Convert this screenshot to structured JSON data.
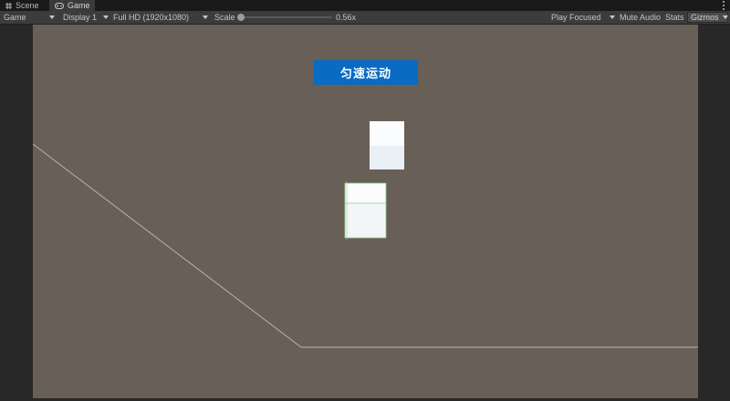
{
  "tabs": [
    {
      "label": "Scene",
      "icon": "grid-icon",
      "active": false
    },
    {
      "label": "Game",
      "icon": "gamepad-icon",
      "active": true
    }
  ],
  "toolbar": {
    "view_mode": "Game",
    "display": "Display 1",
    "resolution": "Full HD (1920x1080)",
    "scale_label": "Scale",
    "scale_value": "0.56x",
    "play_mode": "Play Focused",
    "mute_audio": "Mute Audio",
    "stats": "Stats",
    "gizmos": "Gizmos"
  },
  "viewport": {
    "background": "#685f57",
    "button_label": "匀速运动",
    "button_color": "#0a6bc2"
  }
}
